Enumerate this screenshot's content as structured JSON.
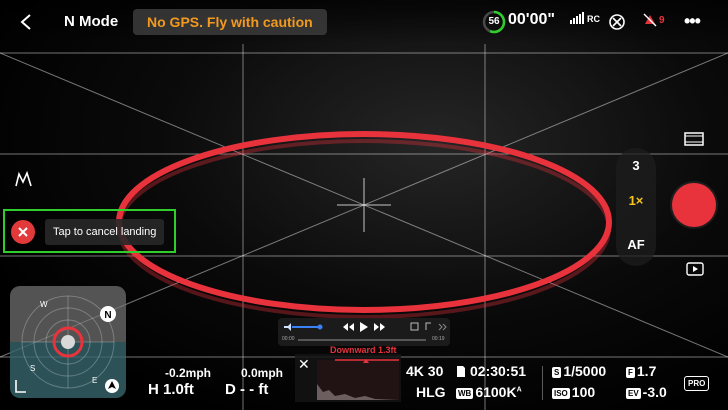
{
  "header": {
    "back_icon": "chevron-left-icon",
    "mode": "N Mode",
    "gps_warning": "No GPS. Fly with caution",
    "battery_percent": "56",
    "flight_time": "00'00\"",
    "rc_label": "RC",
    "rc_signal_icon": "signal-bars-icon",
    "satellite_icon": "satellite-icon",
    "satellite_count": "",
    "warning_count": "9",
    "more_icon": "more-dots-icon"
  },
  "landing": {
    "cancel_label": "Tap to cancel landing",
    "cancel_icon": "close-icon"
  },
  "camera_panel": {
    "count": "3",
    "zoom": "1×",
    "focus": "AF"
  },
  "player": {
    "time_start": "00:00",
    "time_end": "00:19",
    "progress": 0.45
  },
  "downward_label": "Downward 1.3ft",
  "telemetry": {
    "h_speed": "-0.2mph",
    "v_speed": "0.0mph",
    "h_label": "H",
    "h_value": "1.0ft",
    "d_label": "D",
    "d_value": "- - ft"
  },
  "camera_settings": {
    "resolution": "4K 30",
    "color": "HLG",
    "remaining_time": "02:30:51",
    "wb_badge": "WB",
    "white_balance": "6100K",
    "white_balance_mark": "A",
    "shutter_badge": "S",
    "shutter": "1/5000",
    "aperture_badge": "F",
    "aperture": "1.7",
    "iso_badge": "ISO",
    "iso": "100",
    "ev_badge": "EV",
    "ev": "-3.0",
    "pro_label": "PRO"
  },
  "map": {
    "compass_w": "W",
    "compass_n": "N",
    "compass_s": "S",
    "compass_e": "E"
  },
  "colors": {
    "accent_red": "#e8323c",
    "warning_orange": "#f39a1e",
    "battery_green": "#2fce2b",
    "highlight_green": "#2fce2b"
  }
}
